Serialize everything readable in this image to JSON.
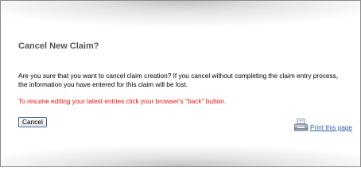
{
  "dialog": {
    "title": "Cancel New Claim?",
    "message": "Are you sure that you want to cancel claim creation? If you cancel without completing the claim entry process, the information you have entered for this claim will be lost.",
    "warning": "To resume editing your latest entries click your browser's \"back\" button.",
    "cancel_label": "Cancel",
    "print_label": "Print this page",
    "print_icon": "printer-icon"
  },
  "colors": {
    "title": "#555555",
    "warning": "#ee1111",
    "link": "#2d5fa8"
  }
}
